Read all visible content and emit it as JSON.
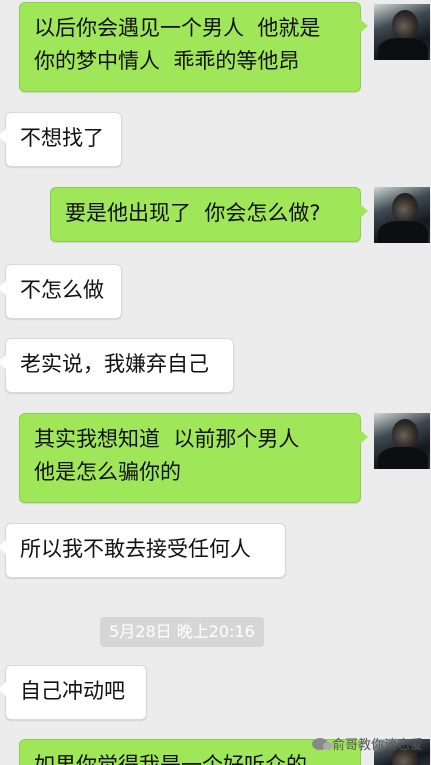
{
  "messages": [
    {
      "side": "out",
      "text": "以后你会遇见一个男人  他就是\n你的梦中情人  乖乖的等他昂"
    },
    {
      "side": "in",
      "text": "不想找了"
    },
    {
      "side": "out",
      "text": "要是他出现了  你会怎么做?"
    },
    {
      "side": "in",
      "text": "不怎么做"
    },
    {
      "side": "in",
      "text": "老实说，我嫌弃自己"
    },
    {
      "side": "out",
      "text": "其实我想知道  以前那个男人\n他是怎么骗你的"
    },
    {
      "side": "in",
      "text": "所以我不敢去接受任何人"
    },
    {
      "side": "in",
      "text": "自己冲动吧"
    },
    {
      "side": "out",
      "text": "如果你觉得我是一个好听众的"
    }
  ],
  "timestamp": "5月28日 晚上20:16",
  "watermark": "俞哥教你谈恋爱",
  "colors": {
    "outgoing_bubble": "#9fe658",
    "incoming_bubble": "#ffffff",
    "background": "#ececec"
  }
}
